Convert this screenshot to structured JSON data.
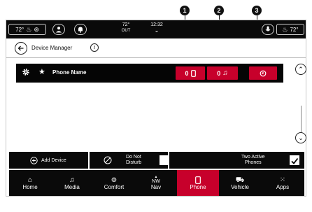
{
  "callouts": [
    "1",
    "2",
    "3"
  ],
  "status_bar": {
    "left_temp": "72°",
    "out_temp": "72°",
    "out_label": "OUT",
    "time": "12:32",
    "right_temp": "72°"
  },
  "header": {
    "title": "Device Manager",
    "info_glyph": "i"
  },
  "phone_row": {
    "name": "Phone Name",
    "calls_count": "0",
    "music_count": "0"
  },
  "actions": {
    "add_device": "Add Device",
    "dnd_line1": "Do Not",
    "dnd_line2": "Disturb",
    "two_active_line1": "Two Active",
    "two_active_line2": "Phones",
    "dnd_checked": false,
    "two_active_checked": true
  },
  "nav": {
    "items": [
      {
        "label": "Home",
        "icon": "home-icon"
      },
      {
        "label": "Media",
        "icon": "music-note-icon"
      },
      {
        "label": "Comfort",
        "icon": "comfort-icon"
      },
      {
        "label": "Nav",
        "icon": "compass-icon",
        "top_text": "NW"
      },
      {
        "label": "Phone",
        "icon": "phone-icon",
        "active": true
      },
      {
        "label": "Vehicle",
        "icon": "car-icon"
      },
      {
        "label": "Apps",
        "icon": "apps-grid-icon"
      }
    ]
  },
  "colors": {
    "accent_red": "#c7002b",
    "bar_black": "#0a0a0a"
  }
}
